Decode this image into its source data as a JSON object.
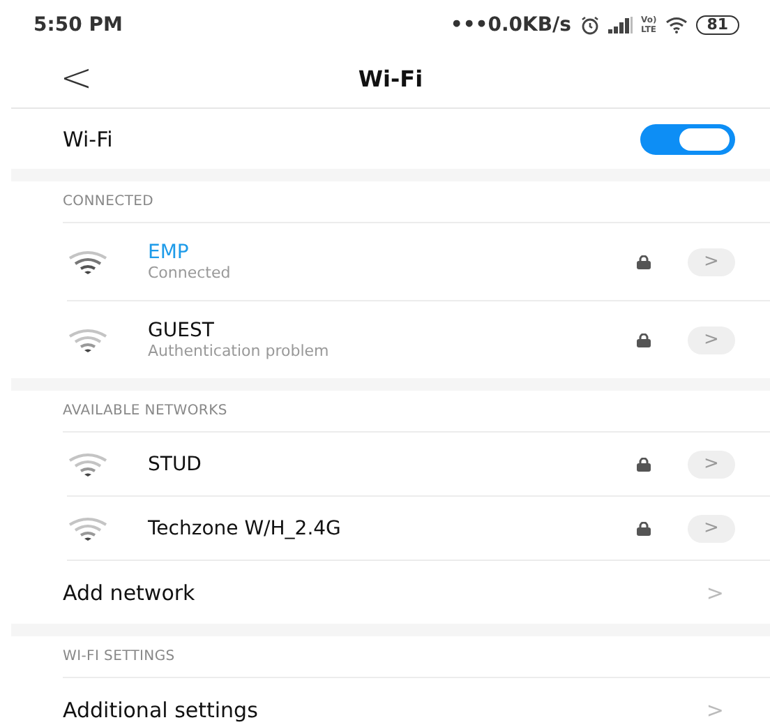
{
  "status_bar": {
    "time": "5:50 PM",
    "speed": "•••0.0KB/s",
    "volte": "Vo)",
    "lte": "LTE",
    "battery": "81"
  },
  "header": {
    "back": "<",
    "title": "Wi-Fi"
  },
  "wifi_toggle": {
    "label": "Wi-Fi",
    "on": true
  },
  "sections": [
    {
      "title": "CONNECTED",
      "items": [
        {
          "kind": "network",
          "name": "EMP",
          "status": "Connected",
          "connected": true,
          "locked": true,
          "arrow": ">"
        },
        {
          "kind": "network",
          "name": "GUEST",
          "status": "Authentication problem",
          "connected": false,
          "locked": true,
          "arrow": ">"
        }
      ]
    },
    {
      "title": "AVAILABLE NETWORKS",
      "items": [
        {
          "kind": "network",
          "name": "STUD",
          "connected": false,
          "locked": true,
          "arrow": ">"
        },
        {
          "kind": "network",
          "name": "Techzone W/H_2.4G",
          "connected": false,
          "locked": true,
          "arrow": ">"
        },
        {
          "kind": "link",
          "name": "Add network",
          "arrow": ">"
        }
      ]
    },
    {
      "title": "WI-FI SETTINGS",
      "items": [
        {
          "kind": "link",
          "name": "Additional settings",
          "arrow": ">"
        }
      ]
    }
  ]
}
